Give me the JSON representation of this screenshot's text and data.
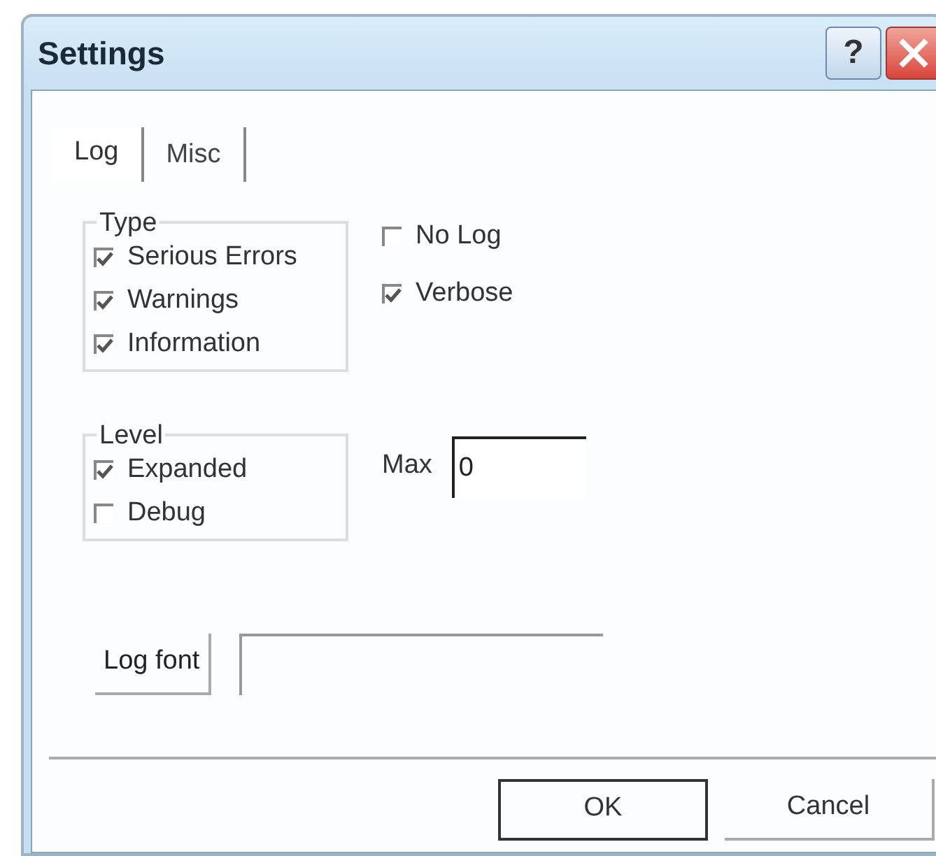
{
  "window": {
    "title": "Settings",
    "help_label": "?"
  },
  "tabs": [
    {
      "label": "Log",
      "selected": true
    },
    {
      "label": "Misc",
      "selected": false
    }
  ],
  "type_group": {
    "title": "Type",
    "checkboxes": [
      {
        "label": "Serious Errors",
        "checked": true
      },
      {
        "label": "Warnings",
        "checked": true
      },
      {
        "label": "Information",
        "checked": true
      }
    ]
  },
  "options": [
    {
      "label": "No Log",
      "checked": false
    },
    {
      "label": "Verbose",
      "checked": true
    }
  ],
  "level_group": {
    "title": "Level",
    "checkboxes": [
      {
        "label": "Expanded",
        "checked": true
      },
      {
        "label": "Debug",
        "checked": false
      }
    ]
  },
  "max": {
    "label": "Max",
    "value": "0"
  },
  "log_font": {
    "button": "Log font"
  },
  "buttons": [
    {
      "label": "OK",
      "default": true
    },
    {
      "label": "Cancel",
      "default": false
    }
  ]
}
